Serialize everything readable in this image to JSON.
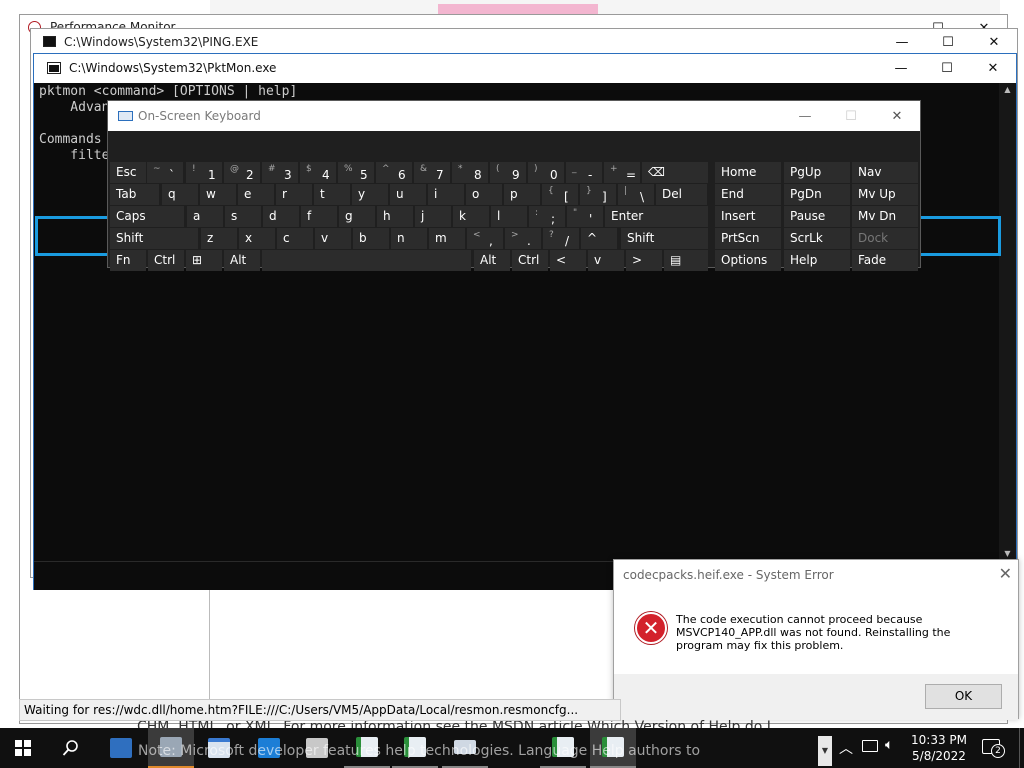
{
  "background": {
    "perfmon_title": "Performance Monitor",
    "ping_title": "C:\\Windows\\System32\\PING.EXE",
    "doc_line1": "CHM, HTML, or XML. For more information see the MSDN article Which Version of Help do I",
    "doc_line2": "Note: Microsoft developer features help technologies. Language Help authors to"
  },
  "console": {
    "title": "C:\\Windows\\System32\\PktMon.exe",
    "lines": [
      "pktmon <command> [OPTIONS | help]",
      "    Advan",
      "",
      "Commands",
      "    filte"
    ]
  },
  "osk": {
    "title": "On-Screen Keyboard",
    "rows": [
      [
        {
          "label": "Esc"
        },
        {
          "sub": "~",
          "main": "`"
        },
        {
          "sub": "!",
          "main": "1"
        },
        {
          "sub": "@",
          "main": "2"
        },
        {
          "sub": "#",
          "main": "3"
        },
        {
          "sub": "$",
          "main": "4"
        },
        {
          "sub": "%",
          "main": "5"
        },
        {
          "sub": "^",
          "main": "6"
        },
        {
          "sub": "&",
          "main": "7"
        },
        {
          "sub": "*",
          "main": "8"
        },
        {
          "sub": "(",
          "main": "9"
        },
        {
          "sub": ")",
          "main": "0"
        },
        {
          "sub": "_",
          "main": "-"
        },
        {
          "sub": "+",
          "main": "="
        },
        {
          "label": "⌫"
        },
        {
          "label": "Home"
        },
        {
          "label": "PgUp"
        },
        {
          "label": "Nav"
        }
      ],
      [
        {
          "label": "Tab"
        },
        {
          "label": "q"
        },
        {
          "label": "w"
        },
        {
          "label": "e"
        },
        {
          "label": "r"
        },
        {
          "label": "t"
        },
        {
          "label": "y"
        },
        {
          "label": "u"
        },
        {
          "label": "i"
        },
        {
          "label": "o"
        },
        {
          "label": "p"
        },
        {
          "sub": "{",
          "main": "["
        },
        {
          "sub": "}",
          "main": "]"
        },
        {
          "sub": "|",
          "main": "\\"
        },
        {
          "label": "Del"
        },
        {
          "label": "End"
        },
        {
          "label": "PgDn"
        },
        {
          "label": "Mv Up"
        }
      ],
      [
        {
          "label": "Caps"
        },
        {
          "label": "a"
        },
        {
          "label": "s"
        },
        {
          "label": "d"
        },
        {
          "label": "f"
        },
        {
          "label": "g"
        },
        {
          "label": "h"
        },
        {
          "label": "j"
        },
        {
          "label": "k"
        },
        {
          "label": "l"
        },
        {
          "sub": ":",
          "main": ";"
        },
        {
          "sub": "\"",
          "main": "'"
        },
        {
          "label": "Enter"
        },
        {
          "label": "Insert"
        },
        {
          "label": "Pause"
        },
        {
          "label": "Mv Dn"
        }
      ],
      [
        {
          "label": "Shift"
        },
        {
          "label": "z"
        },
        {
          "label": "x"
        },
        {
          "label": "c"
        },
        {
          "label": "v"
        },
        {
          "label": "b"
        },
        {
          "label": "n"
        },
        {
          "label": "m"
        },
        {
          "sub": "<",
          "main": ","
        },
        {
          "sub": ">",
          "main": "."
        },
        {
          "sub": "?",
          "main": "/"
        },
        {
          "label": "^"
        },
        {
          "label": "Shift"
        },
        {
          "label": "PrtScn"
        },
        {
          "label": "ScrLk"
        },
        {
          "label": "Dock"
        }
      ],
      [
        {
          "label": "Fn"
        },
        {
          "label": "Ctrl"
        },
        {
          "label": "⊞"
        },
        {
          "label": "Alt"
        },
        {
          "label": ""
        },
        {
          "label": "Alt"
        },
        {
          "label": "Ctrl"
        },
        {
          "label": "<"
        },
        {
          "label": "v"
        },
        {
          "label": ">"
        },
        {
          "label": "▤"
        },
        {
          "label": "Options"
        },
        {
          "label": "Help"
        },
        {
          "label": "Fade"
        }
      ]
    ]
  },
  "dialog": {
    "title": "codecpacks.heif.exe - System Error",
    "message": "The code execution cannot proceed because MSVCP140_APP.dll was not found. Reinstalling the program may fix this problem.",
    "ok_label": "OK"
  },
  "statusbar": {
    "text": "Waiting for res://wdc.dll/home.htm?FILE:///C:/Users/VM5/AppData/Local/resmon.resmoncfg..."
  },
  "taskbar": {
    "time": "10:33 PM",
    "date": "5/8/2022",
    "notification_count": "2"
  }
}
